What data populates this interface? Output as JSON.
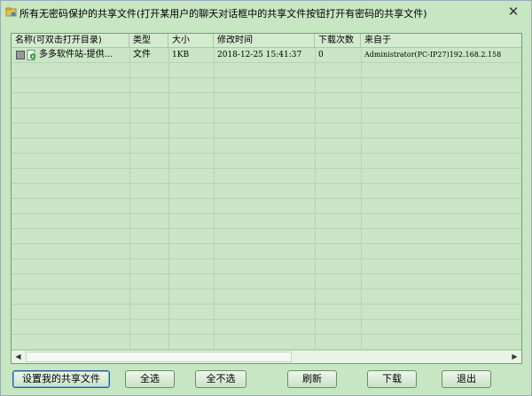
{
  "window": {
    "title": "所有无密码保护的共享文件(打开某用户的聊天对话框中的共享文件按钮打开有密码的共享文件)",
    "close_label": "✕"
  },
  "list": {
    "columns": [
      "名称(可双击打开目录)",
      "类型",
      "大小",
      "修改时间",
      "下载次数",
      "来自于"
    ],
    "rows": [
      {
        "name": "多多软件站-提供...",
        "type": "文件",
        "size": "1KB",
        "modified": "2018-12-25 15:41:37",
        "downloads": "0",
        "from": "Administrator(PC-IP27)192.168.2.158"
      }
    ]
  },
  "buttons": {
    "set_share": "设置我的共享文件",
    "select_all": "全选",
    "select_none": "全不选",
    "refresh": "刷新",
    "download": "下载",
    "exit": "退出"
  },
  "scrollbar": {
    "left_arrow": "◀",
    "right_arrow": "▶"
  }
}
